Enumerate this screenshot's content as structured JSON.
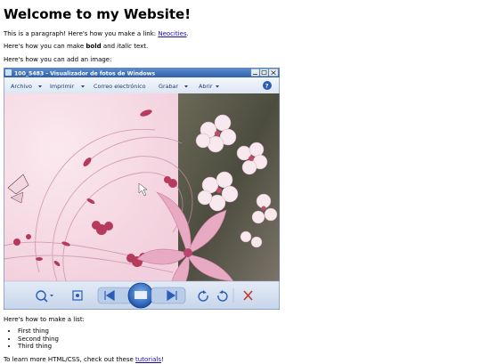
{
  "page": {
    "heading": "Welcome to my Website!",
    "para1_before": "This is a paragraph! Here's how you make a link: ",
    "link_text": "Neocities",
    "para1_after": ".",
    "para2_before": "Here's how you can make ",
    "bold_text": "bold",
    "para2_mid": " and ",
    "italic_text": "italic",
    "para2_after": " text.",
    "para3": "Here's how you can add an image:",
    "para4": "Here's how to make a list:",
    "list": [
      "First thing",
      "Second thing",
      "Third thing"
    ],
    "para5_before": "To learn more HTML/CSS, check out these ",
    "para5_link": "tutorials",
    "para5_after": "!"
  },
  "viewer": {
    "title": "100_5483 - Visualizador de fotos de Windows",
    "menu": [
      "Archivo",
      "Imprimir",
      "Correo electrónico",
      "Grabar",
      "Abrir"
    ],
    "help": "?",
    "colors": {
      "titlebar": "#3a6ea5",
      "toolbar": "#e8eef7",
      "accent": "#2a5db8",
      "close": "#c0392b"
    },
    "icons": [
      "zoom-icon",
      "fit-icon",
      "previous-icon",
      "slideshow-icon",
      "next-icon",
      "rotate-left-icon",
      "rotate-right-icon",
      "delete-icon"
    ]
  }
}
